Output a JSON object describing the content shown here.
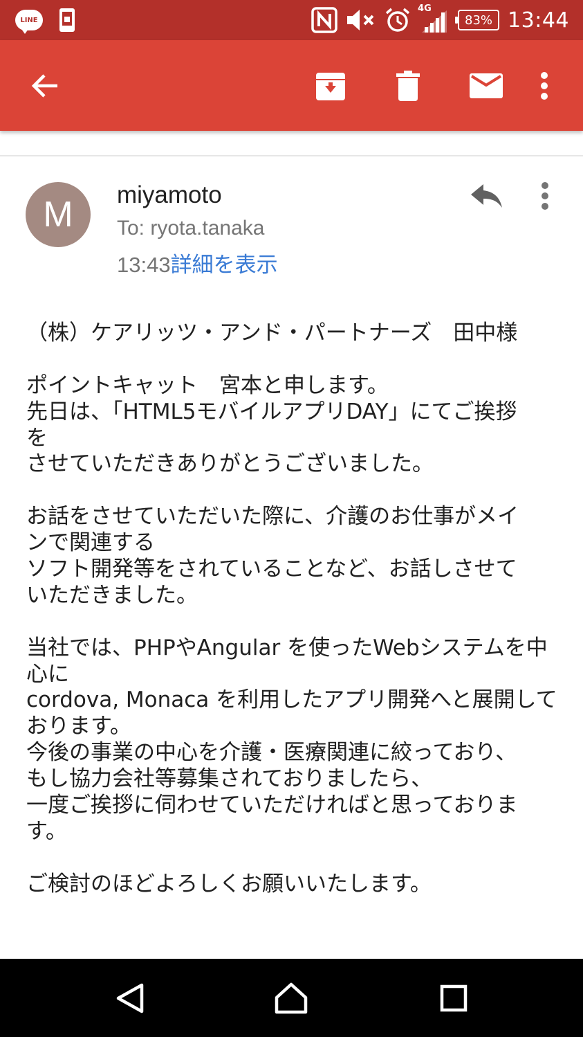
{
  "status_bar": {
    "line_app_label": "LINE",
    "network_label": "4G",
    "battery": "83%",
    "time": "13:44",
    "icons": [
      "line-icon",
      "phone-notification-icon",
      "nfc-icon",
      "volume-mute-icon",
      "alarm-icon",
      "signal-icon",
      "battery-icon"
    ]
  },
  "toolbar": {
    "icons": [
      "back-arrow-icon",
      "archive-icon",
      "delete-icon",
      "mark-unread-icon",
      "more-vert-icon"
    ],
    "background": "#db4437"
  },
  "message": {
    "avatar_initial": "M",
    "avatar_color": "#a48a82",
    "sender": "miyamoto",
    "to": "To: ryota.tanaka",
    "time": "13:43",
    "details_link": "詳細を表示",
    "link_color": "#3a7bd5"
  },
  "body": {
    "lines": [
      "（株）ケアリッツ・アンド・パートナーズ　田中様",
      "",
      "ポイントキャット　宮本と申します。",
      "先日は、「HTML5モバイルアプリDAY」にてご挨拶",
      "を",
      "させていただきありがとうございました。",
      "",
      "お話をさせていただいた際に、介護のお仕事がメイ",
      "ンで関連する",
      "ソフト開発等をされていることなど、お話しさせて",
      "いただきました。",
      "",
      "当社では、PHPやAngular を使ったWebシステムを中",
      "心に",
      "cordova, Monaca を利用したアプリ開発へと展開して",
      "おります。",
      "今後の事業の中心を介護・医療関連に絞っており、",
      "もし協力会社等募集されておりましたら、",
      "一度ご挨拶に伺わせていただければと思っておりま",
      "す。",
      "",
      "ご検討のほどよろしくお願いいたします。"
    ]
  },
  "nav_bar": {
    "icons": [
      "back-triangle-icon",
      "home-icon",
      "recents-square-icon"
    ]
  }
}
